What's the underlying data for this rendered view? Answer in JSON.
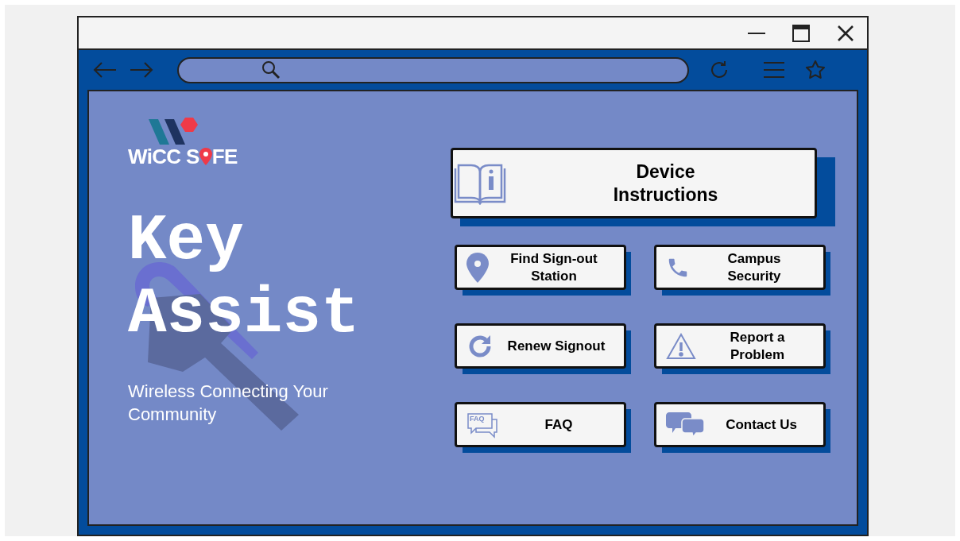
{
  "logo": {
    "before_pin": "WiCC S",
    "after_pin": "FE"
  },
  "hero": {
    "title_lines": [
      "Key",
      "Assist"
    ],
    "tagline": "Wireless Connecting Your Community"
  },
  "main_action": {
    "label_lines": [
      "Device",
      "Instructions"
    ],
    "kind": "book"
  },
  "actions": [
    {
      "label_lines": [
        "Find Sign-out",
        "Station"
      ],
      "kind": "pin"
    },
    {
      "label_lines": [
        "Campus",
        "Security"
      ],
      "kind": "phone"
    },
    {
      "label_lines": [
        "Renew Signout"
      ],
      "kind": "renew"
    },
    {
      "label_lines": [
        "Report a",
        "Problem"
      ],
      "kind": "warning"
    },
    {
      "label_lines": [
        "FAQ"
      ],
      "kind": "faq",
      "icon_text": "FAQ"
    },
    {
      "label_lines": [
        "Contact Us"
      ],
      "kind": "chat"
    }
  ]
}
